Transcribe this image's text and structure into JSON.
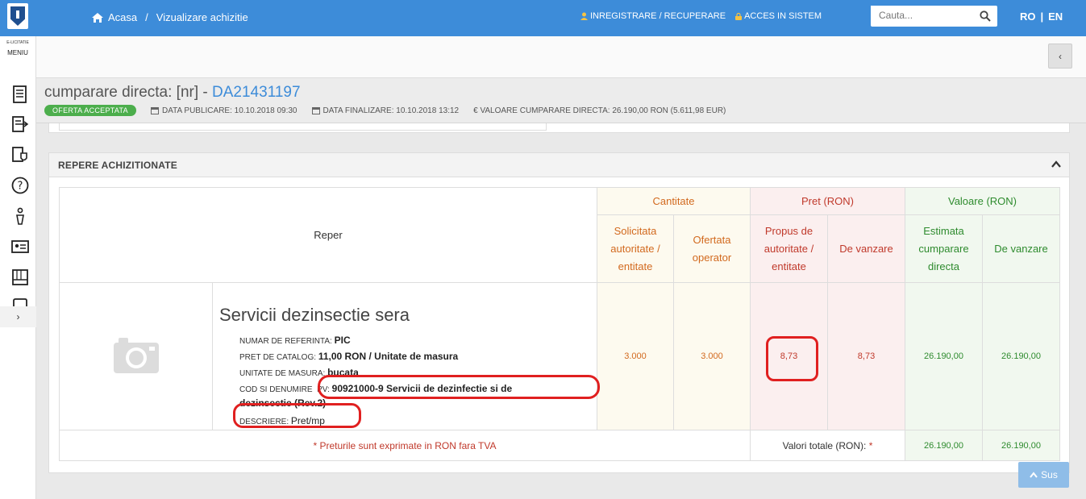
{
  "topbar": {
    "breadcrumb_home": "Acasa",
    "breadcrumb_sep": "/",
    "breadcrumb_current": "Vizualizare achizitie",
    "link_register": "INREGISTRARE / RECUPERARE",
    "link_login": "ACCES IN SISTEM",
    "search_placeholder": "Cauta...",
    "lang_ro": "RO",
    "lang_sep": "|",
    "lang_en": "EN"
  },
  "sidebar": {
    "brand_small": "E-LICITATIE",
    "menu_label": "MENIU",
    "icons": [
      "document-list-icon",
      "export-list-icon",
      "shield-doc-icon",
      "help-icon",
      "person-tree-icon",
      "id-card-icon",
      "catalog-icon",
      "partial-icon"
    ],
    "expand_glyph": "›"
  },
  "header": {
    "collapse_glyph": "‹",
    "title_prefix": "cumparare directa: [nr] -",
    "title_id": "DA21431197",
    "status_badge": "OFERTA ACCEPTATA",
    "data_publicare": "DATA PUBLICARE: 10.10.2018 09:30",
    "data_finalizare": "DATA FINALIZARE: 10.10.2018 13:12",
    "valoare": "€ VALOARE CUMPARARE DIRECTA: 26.190,00  RON (5.611,98  EUR)"
  },
  "panel": {
    "title": "REPERE ACHIZITIONATE",
    "col_reper": "Reper",
    "group_cantitate": "Cantitate",
    "group_pret": "Pret (RON)",
    "group_valoare": "Valoare (RON)",
    "sub_solicitata": "Solicitata autoritate / entitate",
    "sub_ofertata": "Ofertata operator",
    "sub_propus": "Propus de autoritate / entitate",
    "sub_devanzare_pret": "De vanzare",
    "sub_estimata": "Estimata cumparare directa",
    "sub_devanzare_val": "De vanzare",
    "item": {
      "title": "Servicii dezinsectie sera",
      "ref_label": "NUMAR DE REFERINTA:",
      "ref_value": "PIC",
      "pret_label": "PRET DE CATALOG:",
      "pret_value": "11,00  RON / Unitate de masura",
      "um_label": "UNITATE DE MASURA:",
      "um_value": "bucata",
      "cod_label": "COD SI DENUMIRE",
      "cod_pv": "PV:",
      "cod_value": "90921000-9 Servicii de dezinfectie si de dezinsectie (Rev.2)",
      "desc_label": "DESCRIERE:",
      "desc_value": "Pret/mp",
      "solicitata": "3.000",
      "ofertata": "3.000",
      "propus": "8,73",
      "vanzare_pret": "8,73",
      "estimata": "26.190,00",
      "vanzare_val": "26.190,00"
    },
    "footer_note": "* Preturile sunt exprimate in RON fara TVA",
    "footer_label": "Valori totale (RON):",
    "footer_ast": "*",
    "total_estimata": "26.190,00",
    "total_vanzare": "26.190,00"
  },
  "scroll_top_label": "Sus",
  "colors": {
    "topbar": "#3d8cd9",
    "badge": "#4cae4c",
    "highlight": "#e02020"
  }
}
